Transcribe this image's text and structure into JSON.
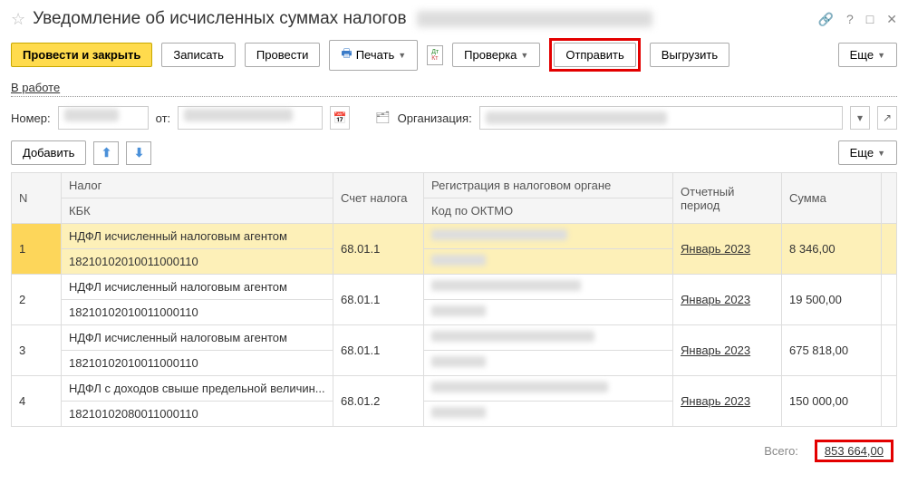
{
  "title": "Уведомление об исчисленных суммах налогов",
  "toolbar": {
    "save_close": "Провести и закрыть",
    "save": "Записать",
    "post": "Провести",
    "print": "Печать",
    "check": "Проверка",
    "send": "Отправить",
    "export": "Выгрузить",
    "more": "Еще"
  },
  "status_link": "В работе",
  "fields": {
    "number_label": "Номер:",
    "from_label": "от:",
    "org_label": "Организация:"
  },
  "actions": {
    "add": "Добавить"
  },
  "table": {
    "headers": {
      "n": "N",
      "tax": "Налог",
      "kbk": "КБК",
      "account": "Счет налога",
      "reg": "Регистрация в налоговом органе",
      "oktmo": "Код по ОКТМО",
      "period": "Отчетный период",
      "sum": "Сумма"
    },
    "rows": [
      {
        "n": "1",
        "tax": "НДФЛ исчисленный налоговым агентом",
        "kbk": "18210102010011000110",
        "account": "68.01.1",
        "period": "Январь 2023",
        "sum": "8 346,00"
      },
      {
        "n": "2",
        "tax": "НДФЛ исчисленный налоговым агентом",
        "kbk": "18210102010011000110",
        "account": "68.01.1",
        "period": "Январь 2023",
        "sum": "19 500,00"
      },
      {
        "n": "3",
        "tax": "НДФЛ исчисленный налоговым агентом",
        "kbk": "18210102010011000110",
        "account": "68.01.1",
        "period": "Январь 2023",
        "sum": "675 818,00"
      },
      {
        "n": "4",
        "tax": "НДФЛ с доходов свыше предельной величин...",
        "kbk": "18210102080011000110",
        "account": "68.01.2",
        "period": "Январь 2023",
        "sum": "150 000,00"
      }
    ]
  },
  "footer": {
    "total_label": "Всего:",
    "total_value": "853 664,00"
  }
}
